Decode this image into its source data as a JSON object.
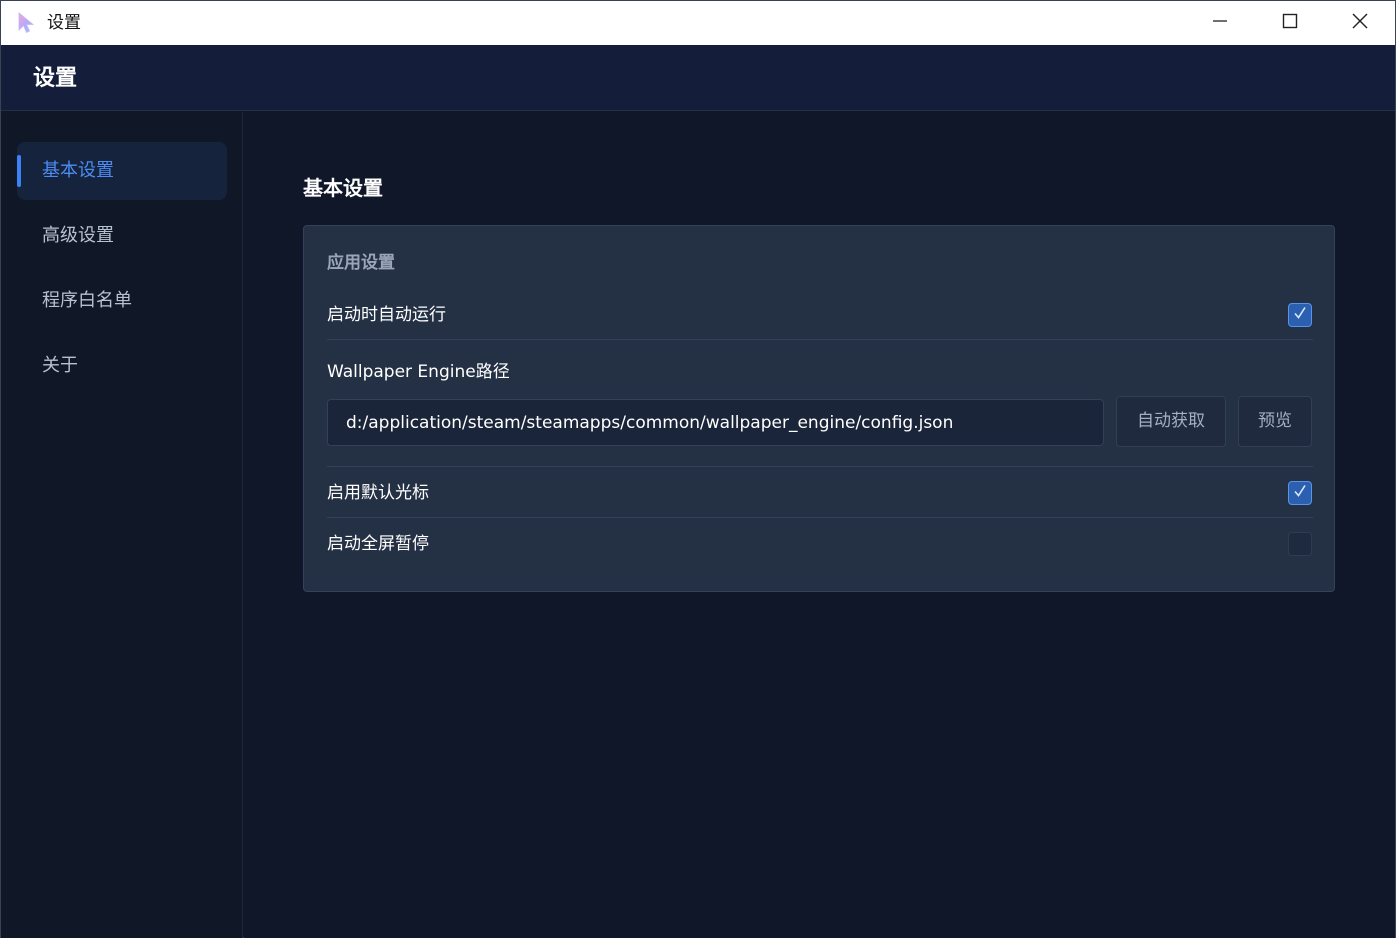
{
  "window": {
    "title": "设置",
    "icons": {
      "app": "cursor-app-icon",
      "minimize": "minimize-icon",
      "maximize": "maximize-icon",
      "close": "close-icon"
    }
  },
  "header": {
    "title": "设置"
  },
  "sidebar": {
    "items": [
      {
        "label": "基本设置",
        "active": true
      },
      {
        "label": "高级设置",
        "active": false
      },
      {
        "label": "程序白名单",
        "active": false
      },
      {
        "label": "关于",
        "active": false
      }
    ]
  },
  "main": {
    "section_title": "基本设置",
    "group_title": "应用设置",
    "settings": {
      "autostart": {
        "label": "启动时自动运行",
        "checked": true
      },
      "wallpaper_path": {
        "label": "Wallpaper Engine路径",
        "value": "d:/application/steam/steamapps/common/wallpaper_engine/config.json",
        "auto_button": "自动获取",
        "preview_button": "预览"
      },
      "default_cursor": {
        "label": "启用默认光标",
        "checked": true
      },
      "fullscreen_pause": {
        "label": "启动全屏暂停",
        "checked": false
      }
    }
  },
  "colors": {
    "accent": "#3b82f6",
    "background": "#0f1729",
    "header": "#141d3a",
    "card": "#243044"
  }
}
